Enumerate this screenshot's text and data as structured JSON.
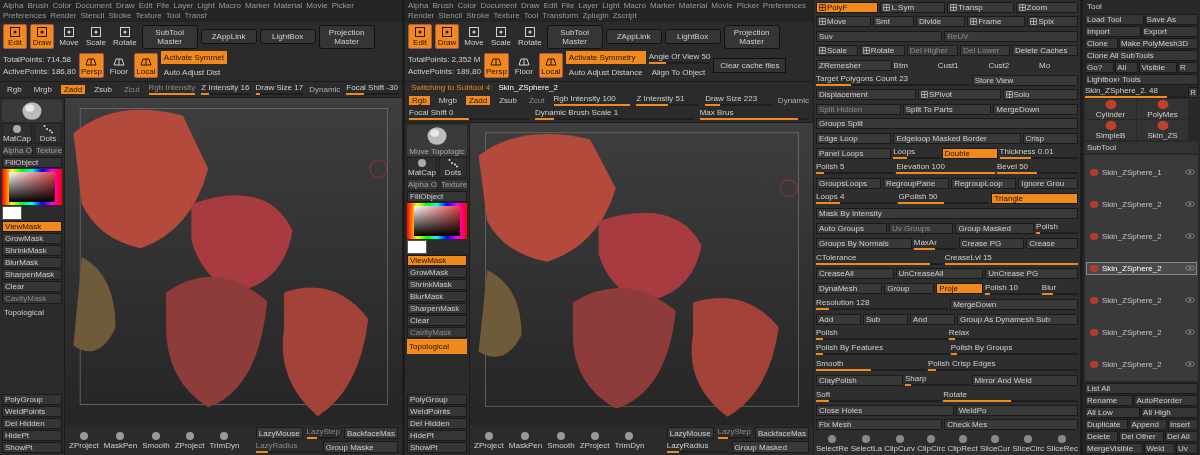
{
  "windows": [
    {
      "menu": [
        "Alpha",
        "Brush",
        "Color",
        "Document",
        "Draw",
        "Edit",
        "File",
        "Layer",
        "Light",
        "Macro",
        "Marker",
        "Material",
        "Movie",
        "Picker",
        "Preferences",
        "Render",
        "Stencil",
        "Stroke",
        "Texture",
        "Tool",
        "Transf"
      ],
      "tools": [
        {
          "label": "Edit",
          "selected": true
        },
        {
          "label": "Draw",
          "selected": true
        },
        {
          "label": "Move",
          "selected": false
        },
        {
          "label": "Scale",
          "selected": false
        },
        {
          "label": "Rotate",
          "selected": false
        }
      ],
      "top_buttons": [
        "SubTool Master",
        "ZAppLink",
        "LightBox",
        "Projection Master"
      ],
      "points": [
        "TotalPoints: 714,58",
        "ActivePoints: 186,80"
      ],
      "view_buttons": [
        {
          "label": "Persp",
          "selected": true
        },
        {
          "label": "Floor",
          "selected": false
        },
        {
          "label": "Local",
          "selected": true
        }
      ],
      "symmetry": [
        {
          "label": "Activate Symmet",
          "selected": true
        },
        {
          "label": "Auto Adjust Dist",
          "selected": false
        }
      ],
      "draw_bar": [
        {
          "kind": "toggle",
          "label": "Rgb",
          "selected": false,
          "disabled": false
        },
        {
          "kind": "toggle",
          "label": "Mrgb",
          "selected": false,
          "disabled": false
        },
        {
          "kind": "toggle",
          "label": "Zadd",
          "selected": true,
          "disabled": false
        },
        {
          "kind": "toggle",
          "label": "Zsub",
          "selected": false,
          "disabled": false
        },
        {
          "kind": "toggle",
          "label": "Zcut",
          "selected": false,
          "disabled": true
        },
        {
          "kind": "slider",
          "label": "Rgb Intensity",
          "level": 1,
          "disabled": true
        },
        {
          "kind": "slider",
          "label": "Z Intensity 16",
          "level": 0.16,
          "disabled": false
        },
        {
          "kind": "slider",
          "label": "Draw Size 17",
          "level": 0.1,
          "disabled": false
        },
        {
          "kind": "text",
          "label": "Dynamic"
        },
        {
          "kind": "slider",
          "label": "Focal Shift -30",
          "level": 0.35,
          "disabled": false
        }
      ],
      "shelf": {
        "matcap": "MatCap",
        "stroke": "Dots",
        "alpha": "Alpha O",
        "texture": "Texture",
        "fill": "FillObject",
        "buttons": [
          {
            "label": "ViewMask",
            "selected": true,
            "disabled": false
          },
          {
            "label": "GrowMask",
            "selected": false,
            "disabled": false
          },
          {
            "label": "ShrinkMask",
            "selected": false,
            "disabled": false
          },
          {
            "label": "BlurMask",
            "selected": false,
            "disabled": false
          },
          {
            "label": "SharpenMask",
            "selected": false,
            "disabled": false
          },
          {
            "label": "Clear",
            "selected": false,
            "disabled": false
          },
          {
            "label": "CavityMask",
            "selected": false,
            "disabled": true
          }
        ],
        "topological": {
          "label": "Topological",
          "selected": false
        },
        "poly_buttons": [
          "PolyGroup",
          "WeldPoints",
          "Del Hidden",
          "HidePt",
          "ShowPt"
        ]
      },
      "bottom": {
        "icons": [
          "ZProject",
          "MaskPen",
          "Smooth",
          "ZProject",
          "TrimDyn"
        ],
        "rows": [
          [
            {
              "kind": "toggle",
              "label": "LazyMouse",
              "selected": false,
              "disabled": false
            },
            {
              "kind": "slider",
              "label": "LazyStep",
              "level": 0.3,
              "disabled": true
            },
            {
              "kind": "toggle",
              "label": "BackfaceMas",
              "selected": false,
              "disabled": false
            }
          ],
          [
            {
              "kind": "slider",
              "label": "LazyRadius",
              "level": 0.2,
              "disabled": true
            },
            {
              "kind": "toggle",
              "label": "Group Maske",
              "selected": false,
              "disabled": false
            }
          ]
        ]
      }
    },
    {
      "menu": [
        "Alpha",
        "Brush",
        "Color",
        "Document",
        "Draw",
        "Edit",
        "File",
        "Layer",
        "Light",
        "Macro",
        "Marker",
        "Material",
        "Movie",
        "Picker",
        "Preferences",
        "Render",
        "Stencil",
        "Stroke",
        "Texture",
        "Tool",
        "Transform",
        "Zplugin",
        "Zscript"
      ],
      "tools": [
        {
          "label": "Edit",
          "selected": true
        },
        {
          "label": "Draw",
          "selected": true
        },
        {
          "label": "Move",
          "selected": false
        },
        {
          "label": "Scale",
          "selected": false
        },
        {
          "label": "Rotate",
          "selected": false
        }
      ],
      "top_buttons": [
        "SubTool Master",
        "ZAppLink",
        "LightBox",
        "Projection Master"
      ],
      "points": [
        "TotalPoints: 2,352 M",
        "ActivePoints: 189,80"
      ],
      "view_buttons": [
        {
          "label": "Persp",
          "selected": true
        },
        {
          "label": "Floor",
          "selected": false
        },
        {
          "label": "Local",
          "selected": true
        }
      ],
      "symmetry": [
        {
          "label": "Activate Symmetry",
          "selected": true
        },
        {
          "label": "Auto Adjust Distance",
          "selected": false
        }
      ],
      "extra": {
        "angle": {
          "label": "Angle Of View 50",
          "level": 0.28
        },
        "align": "Align To Object",
        "cache": "Clear cache files"
      },
      "notice": {
        "label": "Switching to Subtool 4:",
        "value": "Skin_ZSphere_2"
      },
      "draw_bar": [
        {
          "kind": "toggle",
          "label": "Rgb",
          "selected": true,
          "disabled": false
        },
        {
          "kind": "toggle",
          "label": "Mrgb",
          "selected": false,
          "disabled": false
        },
        {
          "kind": "toggle",
          "label": "Zadd",
          "selected": true,
          "disabled": false
        },
        {
          "kind": "toggle",
          "label": "Zsub",
          "selected": false,
          "disabled": false
        },
        {
          "kind": "toggle",
          "label": "Zcut",
          "selected": false,
          "disabled": true
        },
        {
          "kind": "slider",
          "label": "Rgb Intensity 100",
          "level": 1,
          "disabled": false
        },
        {
          "kind": "slider",
          "label": "Z Intensity 51",
          "level": 0.51,
          "disabled": false
        },
        {
          "kind": "slider",
          "label": "Draw Size 223",
          "level": 0.22,
          "disabled": false
        },
        {
          "kind": "text",
          "label": "Dynamic"
        },
        {
          "kind": "slider",
          "label": "Focal Shift 0",
          "level": 0.5,
          "disabled": false
        },
        {
          "kind": "slider",
          "label": "Dynamic Brush Scale 1",
          "level": 0.12,
          "disabled": false
        },
        {
          "kind": "slider",
          "label": "Max Brus",
          "level": 0.9,
          "disabled": false
        }
      ],
      "shelf": {
        "brush_label": "Move Topologic",
        "matcap": "MatCap",
        "stroke": "Dots",
        "alpha": "Alpha O",
        "texture": "Texture",
        "fill": "FillObject",
        "buttons": [
          {
            "label": "ViewMask",
            "selected": true,
            "disabled": false
          },
          {
            "label": "GrowMask",
            "selected": false,
            "disabled": false
          },
          {
            "label": "ShrinkMask",
            "selected": false,
            "disabled": false
          },
          {
            "label": "BlurMask",
            "selected": false,
            "disabled": false
          },
          {
            "label": "SharpenMask",
            "selected": false,
            "disabled": false
          },
          {
            "label": "Clear",
            "selected": false,
            "disabled": false
          },
          {
            "label": "CavityMask",
            "selected": false,
            "disabled": true
          }
        ],
        "topological": {
          "label": "Topological",
          "selected": true
        },
        "poly_buttons": [
          "PolyGroup",
          "WeldPoints",
          "Del Hidden",
          "HidePt",
          "ShowPt"
        ]
      },
      "bottom": {
        "icons": [
          "ZProject",
          "MaskPen",
          "Smooth",
          "ZProject",
          "TrimDyn"
        ],
        "rows": [
          [
            {
              "kind": "toggle",
              "label": "LazyMouse",
              "selected": false,
              "disabled": false
            },
            {
              "kind": "slider",
              "label": "LazyStep",
              "level": 0.3,
              "disabled": true
            },
            {
              "kind": "toggle",
              "label": "BackfaceMas",
              "selected": false,
              "disabled": false
            }
          ],
          [
            {
              "kind": "slider",
              "label": "LazyRadius",
              "level": 0.2,
              "disabled": false
            },
            {
              "kind": "toggle",
              "label": "Group Masked",
              "selected": false,
              "disabled": false
            }
          ]
        ]
      },
      "panel": {
        "rows": [
          [
            {
              "kind": "icon",
              "label": "PolyF",
              "selected": true,
              "disabled": false
            },
            {
              "kind": "icon",
              "label": "L.Sym",
              "selected": false,
              "disabled": false
            },
            {
              "kind": "icon",
              "label": "Transp",
              "selected": false,
              "disabled": false
            },
            {
              "kind": "icon",
              "label": "Zoom",
              "selected": false,
              "disabled": false
            }
          ],
          [
            {
              "kind": "icon",
              "label": "Move",
              "selected": false,
              "disabled": false
            },
            {
              "kind": "button",
              "label": "Smt",
              "selected": false,
              "disabled": false
            },
            {
              "kind": "button",
              "label": "Divide",
              "selected": false,
              "disabled": false
            },
            {
              "kind": "icon",
              "label": "Frame",
              "selected": false,
              "disabled": false
            },
            {
              "kind": "icon",
              "label": "Spix",
              "selected": false,
              "disabled": false
            }
          ],
          [
            {
              "kind": "button",
              "label": "Suv",
              "selected": false,
              "disabled": false
            },
            {
              "kind": "button",
              "label": "ReUV",
              "selected": false,
              "disabled": true
            }
          ],
          [
            {
              "kind": "icon",
              "label": "Scale",
              "selected": false,
              "disabled": false
            },
            {
              "kind": "icon",
              "label": "Rotate",
              "selected": false,
              "disabled": false
            },
            {
              "kind": "button",
              "label": "Del Higher",
              "selected": false,
              "disabled": true
            },
            {
              "kind": "button",
              "label": "Del Lower",
              "selected": false,
              "disabled": true
            },
            {
              "kind": "button",
              "label": "Delete Caches",
              "selected": false,
              "disabled": false
            }
          ],
          [
            {
              "kind": "button",
              "label": "ZRemesher",
              "selected": false,
              "disabled": false
            },
            {
              "kind": "text",
              "label": "Btm"
            },
            {
              "kind": "text",
              "label": "Cust1"
            },
            {
              "kind": "text",
              "label": "Cust2"
            },
            {
              "kind": "text",
              "label": "Mo"
            }
          ],
          [
            {
              "kind": "slider",
              "label": "Target Polygons Count 23",
              "level": 0.23,
              "disabled": false
            },
            {
              "kind": "button",
              "label": "Store View",
              "selected": false,
              "disabled": false
            }
          ],
          [
            {
              "kind": "button",
              "label": "Displacement",
              "selected": false,
              "disabled": false
            },
            {
              "kind": "icon",
              "label": "SPivot",
              "selected": false,
              "disabled": false
            },
            {
              "kind": "icon",
              "label": "Solo",
              "selected": false,
              "disabled": false
            }
          ],
          [
            {
              "kind": "button",
              "label": "Split Hidden",
              "selected": false,
              "disabled": true
            },
            {
              "kind": "button",
              "label": "Split To Parts",
              "selected": false,
              "disabled": false
            },
            {
              "kind": "button",
              "label": "MergeDown",
              "selected": false,
              "disabled": false
            }
          ],
          [
            {
              "kind": "button",
              "label": "Groups Split",
              "selected": false,
              "disabled": false
            }
          ],
          [
            {
              "kind": "button",
              "label": "Edge Loop",
              "selected": false,
              "disabled": false
            },
            {
              "kind": "button",
              "label": "Edgeloop Masked Border",
              "selected": false,
              "disabled": false
            },
            {
              "kind": "button",
              "label": "Crisp",
              "selected": false,
              "disabled": false
            }
          ],
          [
            {
              "kind": "button",
              "label": "Panel Loops",
              "selected": false,
              "disabled": false
            },
            {
              "kind": "slider",
              "label": "Loops",
              "level": 0.3,
              "disabled": false
            },
            {
              "kind": "button",
              "label": "Double",
              "selected": true,
              "disabled": false
            },
            {
              "kind": "slider",
              "label": "Thickness 0.01",
              "level": 0.4,
              "disabled": false
            }
          ],
          [
            {
              "kind": "slider",
              "label": "Polish 5",
              "level": 0.1,
              "disabled": false
            },
            {
              "kind": "slider",
              "label": "Elevation 100",
              "level": 1,
              "disabled": false
            },
            {
              "kind": "slider",
              "label": "Bevel 50",
              "level": 0.5,
              "disabled": false
            }
          ],
          [
            {
              "kind": "button",
              "label": "GroupsLoops",
              "selected": false,
              "disabled": false
            },
            {
              "kind": "button",
              "label": "RegroupPane",
              "selected": false,
              "disabled": false
            },
            {
              "kind": "button",
              "label": "RegroupLoop",
              "selected": false,
              "disabled": false
            },
            {
              "kind": "button",
              "label": "Ignore Grou",
              "selected": false,
              "disabled": false
            }
          ],
          [
            {
              "kind": "slider",
              "label": "Loops 4",
              "level": 0.3,
              "disabled": false
            },
            {
              "kind": "slider",
              "label": "GPolish 50",
              "level": 0.5,
              "disabled": false
            },
            {
              "kind": "button",
              "label": "Triangle",
              "selected": true,
              "disabled": false
            }
          ],
          [
            {
              "kind": "button",
              "label": "Mask By Intensity",
              "selected": false,
              "disabled": false
            }
          ],
          [
            {
              "kind": "button",
              "label": "Auto Groups",
              "selected": false,
              "disabled": false
            },
            {
              "kind": "button",
              "label": "Uv Groups",
              "selected": false,
              "disabled": true
            },
            {
              "kind": "button",
              "label": "Group Masked",
              "selected": false,
              "disabled": false
            },
            {
              "kind": "slider",
              "label": "Polish",
              "level": 0.1,
              "disabled": false
            }
          ],
          [
            {
              "kind": "button",
              "label": "Groups By Normals",
              "selected": false,
              "disabled": false
            },
            {
              "kind": "slider",
              "label": "MaxAr",
              "level": 0.5,
              "disabled": false
            },
            {
              "kind": "button",
              "label": "Crease PG",
              "selected": false,
              "disabled": false
            },
            {
              "kind": "button",
              "label": "Crease",
              "selected": false,
              "disabled": false
            }
          ],
          [
            {
              "kind": "slider",
              "label": "CTolerance",
              "level": 0.9,
              "disabled": false
            },
            {
              "kind": "slider",
              "label": "CreaseLvl 15",
              "level": 1,
              "disabled": false
            }
          ],
          [
            {
              "kind": "button",
              "label": "CreaseAll",
              "selected": false,
              "disabled": false
            },
            {
              "kind": "button",
              "label": "UnCreaseAll",
              "selected": false,
              "disabled": false
            },
            {
              "kind": "button",
              "label": "UnCrease PG",
              "selected": false,
              "disabled": false
            }
          ],
          [
            {
              "kind": "button",
              "label": "DynaMesh",
              "selected": false,
              "disabled": false
            },
            {
              "kind": "button",
              "label": "Group",
              "selected": false,
              "disabled": false
            },
            {
              "kind": "button",
              "label": "Proje",
              "selected": true,
              "disabled": false
            },
            {
              "kind": "slider",
              "label": "Polish 10",
              "level": 0.1,
              "disabled": false
            },
            {
              "kind": "slider",
              "label": "Blur",
              "level": 0.3,
              "disabled": false
            }
          ],
          [
            {
              "kind": "slider",
              "label": "Resolution 128",
              "level": 0.1,
              "disabled": false
            },
            {
              "kind": "button",
              "label": "MergeDown",
              "selected": false,
              "disabled": false
            }
          ],
          [
            {
              "kind": "button",
              "label": "Add",
              "selected": false,
              "disabled": false
            },
            {
              "kind": "button",
              "label": "Sub",
              "selected": false,
              "disabled": false
            },
            {
              "kind": "button",
              "label": "And",
              "selected": false,
              "disabled": false
            },
            {
              "kind": "button",
              "label": "Group As Dynamesh Sub",
              "selected": false,
              "disabled": false
            }
          ],
          [
            {
              "kind": "slider",
              "label": "Polish",
              "level": 0.05,
              "disabled": false
            },
            {
              "kind": "slider",
              "label": "Relax",
              "level": 0.05,
              "disabled": false
            }
          ],
          [
            {
              "kind": "slider",
              "label": "Polish By Features",
              "level": 0.05,
              "disabled": false
            },
            {
              "kind": "slider",
              "label": "Polish By Groups",
              "level": 0.05,
              "disabled": false
            }
          ],
          [
            {
              "kind": "slider",
              "label": "Smooth",
              "level": 0.5,
              "disabled": false
            },
            {
              "kind": "slider",
              "label": "Polish Crisp Edges",
              "level": 0.05,
              "disabled": false
            }
          ],
          [
            {
              "kind": "button",
              "label": "ClayPolish",
              "selected": false,
              "disabled": false
            },
            {
              "kind": "slider",
              "label": "Sharp",
              "level": 0.1,
              "disabled": false
            },
            {
              "kind": "button",
              "label": "Mirror And Weld",
              "selected": false,
              "disabled": false
            }
          ],
          [
            {
              "kind": "slider",
              "label": "Soft",
              "level": 0.1,
              "disabled": false
            },
            {
              "kind": "slider",
              "label": "Rotate",
              "level": 0.5,
              "disabled": false
            }
          ],
          [
            {
              "kind": "button",
              "label": "Close Holes",
              "selected": false,
              "disabled": false
            },
            {
              "kind": "button",
              "label": "WeldPo",
              "selected": false,
              "disabled": false
            }
          ],
          [
            {
              "kind": "button",
              "label": "Fix Mesh",
              "selected": false,
              "disabled": false
            },
            {
              "kind": "button",
              "label": "Check Mes",
              "selected": false,
              "disabled": false
            }
          ]
        ],
        "brushes": [
          "SelectRe",
          "SelectLa",
          "ClipCurv",
          "ClipCirc",
          "ClipRect",
          "SliceCur",
          "SliceCirc",
          "SliceRec"
        ]
      }
    }
  ],
  "tool_panel": {
    "title": "Tool",
    "rows": [
      [
        "Load Tool",
        "Save As"
      ],
      [
        "Import",
        "Export"
      ],
      [
        "Clone",
        "Make PolyMesh3D"
      ],
      [
        "Clone All SubTools"
      ],
      [
        "Go?",
        "All",
        "Visible",
        "R"
      ],
      [
        "Lightbox› Tools"
      ]
    ],
    "current": {
      "label": "Skin_ZSphere_2. 48",
      "level": 0.8,
      "button": "R"
    },
    "thumbnails": [
      "Cylinder",
      "PolyMes",
      "SimpleB",
      "Skin_ZS"
    ],
    "subtool_title": "SubTool",
    "subtools": [
      {
        "name": "Skin_ZSphere_1",
        "selected": false
      },
      {
        "name": "Skin_ZSphere_2",
        "selected": false
      },
      {
        "name": "Skin_ZSphere_2",
        "selected": false
      },
      {
        "name": "Skin_ZSphere_2",
        "selected": true
      },
      {
        "name": "Skin_ZSphere_2",
        "selected": false
      },
      {
        "name": "Skin_ZSphere_2",
        "selected": false
      },
      {
        "name": "Skin_ZSphere_2",
        "selected": false
      }
    ],
    "actions": [
      [
        "List All"
      ],
      [
        "Rename",
        "AutoReorder"
      ],
      [
        "All Low",
        "All High"
      ],
      [
        "Duplicate",
        "Append",
        "Insert"
      ],
      [
        "Delete",
        "Del Other",
        "Del All"
      ],
      [
        "MergeVisible",
        "Weld",
        "Uv"
      ]
    ]
  }
}
